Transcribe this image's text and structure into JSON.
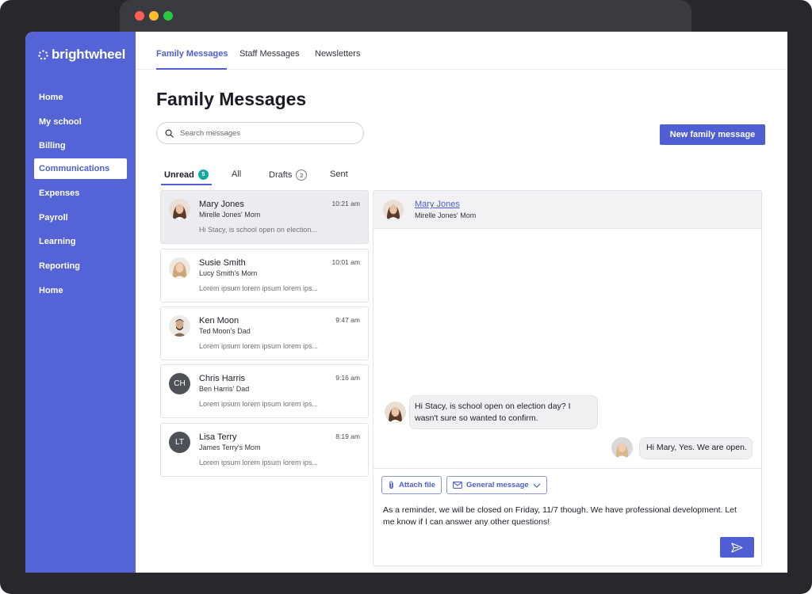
{
  "brand": {
    "name": "brightwheel"
  },
  "sidebar": {
    "items": [
      {
        "label": "Home",
        "active": false
      },
      {
        "label": "My school",
        "active": false
      },
      {
        "label": "Billing",
        "active": false
      },
      {
        "label": "Communications",
        "active": true
      },
      {
        "label": "Expenses",
        "active": false
      },
      {
        "label": "Payroll",
        "active": false
      },
      {
        "label": "Learning",
        "active": false
      },
      {
        "label": "Reporting",
        "active": false
      },
      {
        "label": "Home",
        "active": false
      }
    ]
  },
  "topnav": {
    "tabs": [
      {
        "label": "Family Messages",
        "active": true
      },
      {
        "label": "Staff Messages",
        "active": false
      },
      {
        "label": "Newsletters",
        "active": false
      }
    ]
  },
  "page": {
    "title": "Family Messages",
    "search_placeholder": "Search messages",
    "new_button": "New family message"
  },
  "message_tabs": [
    {
      "label": "Unread",
      "count": "5",
      "active": true
    },
    {
      "label": "All",
      "count": "",
      "active": false
    },
    {
      "label": "Drafts",
      "count": "2",
      "active": false
    },
    {
      "label": "Sent",
      "count": "",
      "active": false
    }
  ],
  "conversations": [
    {
      "name": "Mary Jones",
      "relation": "Mirelle Jones' Mom",
      "time": "10:21 am",
      "preview": "Hi Stacy, is school open on election...",
      "initials": "",
      "avatar": "photo-woman-dark-hair",
      "selected": true
    },
    {
      "name": "Susie Smith",
      "relation": "Lucy Smith's Mom",
      "time": "10:01 am",
      "preview": "Lorem ipsum lorem ipsum lorem ips...",
      "initials": "",
      "avatar": "photo-woman-blonde",
      "selected": false
    },
    {
      "name": "Ken Moon",
      "relation": "Ted Moon's Dad",
      "time": "9:47 am",
      "preview": "Lorem ipsum lorem ipsum lorem ips...",
      "initials": "",
      "avatar": "photo-man-beard",
      "selected": false
    },
    {
      "name": "Chris Harris",
      "relation": "Ben Harris' Dad",
      "time": "9:16 am",
      "preview": "Lorem ipsum lorem ipsum lorem ips...",
      "initials": "CH",
      "avatar": "",
      "selected": false
    },
    {
      "name": "Lisa Terry",
      "relation": "James Terry's Mom",
      "time": "8:19 am",
      "preview": "Lorem ipsum lorem ipsum lorem ips...",
      "initials": "LT",
      "avatar": "",
      "selected": false
    }
  ],
  "chat": {
    "name": "Mary Jones",
    "relation": "Mirelle Jones' Mom",
    "incoming": "Hi Stacy, is school open on election day? I wasn't sure so wanted to confirm.",
    "outgoing": "Hi Mary, Yes. We are open.",
    "attach_label": "Attach file",
    "type_label": "General message",
    "draft": "As a reminder, we will be closed on Friday, 11/7 though. We have professional development. Let me know if I can answer any other questions!"
  },
  "colors": {
    "brand": "#5463d6",
    "accent": "#4f5ed3",
    "badge": "#14a8a5"
  }
}
